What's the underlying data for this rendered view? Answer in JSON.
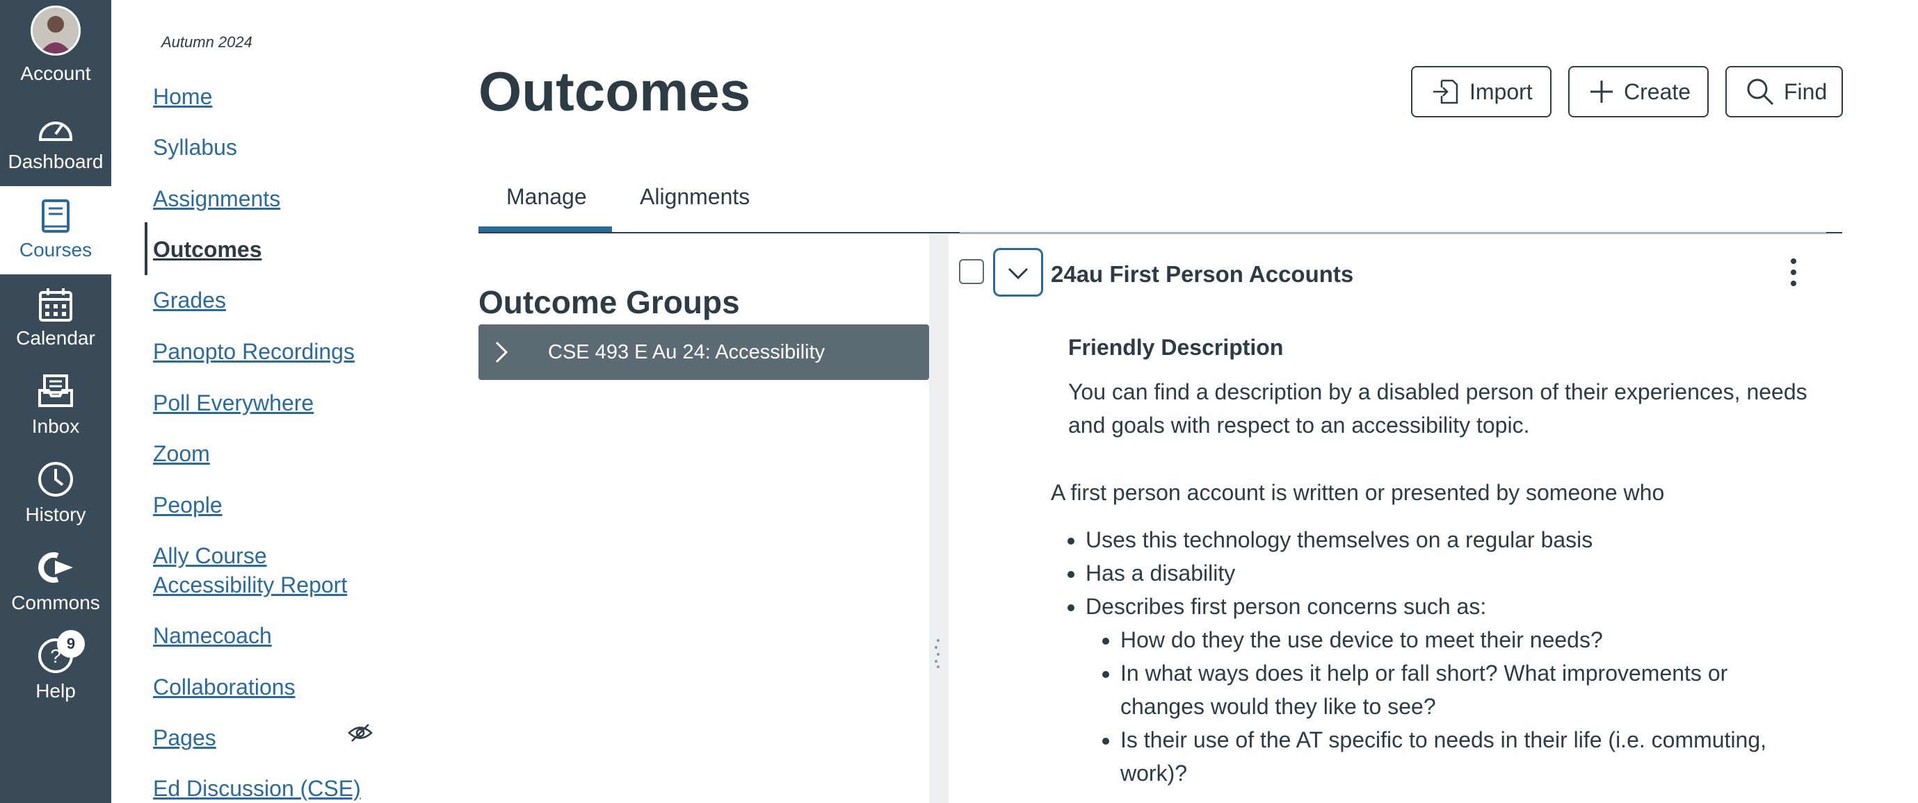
{
  "global_nav": {
    "account": "Account",
    "dashboard": "Dashboard",
    "courses": "Courses",
    "calendar": "Calendar",
    "inbox": "Inbox",
    "history": "History",
    "commons": "Commons",
    "help": "Help",
    "help_badge": "9"
  },
  "course_nav": {
    "term": "Autumn 2024",
    "items": [
      {
        "label": "Home"
      },
      {
        "label": "Syllabus"
      },
      {
        "label": "Assignments"
      },
      {
        "label": "Outcomes"
      },
      {
        "label": "Grades"
      },
      {
        "label": "Panopto Recordings"
      },
      {
        "label": "Poll Everywhere"
      },
      {
        "label": "Zoom"
      },
      {
        "label": "People"
      },
      {
        "label": "Ally Course",
        "label2": "Accessibility Report"
      },
      {
        "label": "Namecoach"
      },
      {
        "label": "Collaborations"
      },
      {
        "label": "Pages"
      },
      {
        "label": "Ed Discussion (CSE)"
      }
    ]
  },
  "header": {
    "title": "Outcomes",
    "import_label": "Import",
    "create_label": "Create",
    "find_label": "Find"
  },
  "tabs": [
    {
      "label": "Manage"
    },
    {
      "label": "Alignments"
    }
  ],
  "groups": {
    "title": "Outcome Groups",
    "items": [
      {
        "label": "CSE 493 E Au 24: Accessibility"
      }
    ]
  },
  "outcome": {
    "title": "24au First Person Accounts",
    "friendly_label": "Friendly Description",
    "friendly_text": "You can find a description by a disabled person of their experiences, needs and goals with respect to an accessibility topic.",
    "intro": "A first person account is written or presented by someone who",
    "bullets": [
      "Uses this technology themselves on a regular basis",
      "Has a disability",
      "Describes first person concerns such as:"
    ],
    "sub_bullets": [
      "How do they the use device to meet their needs?",
      "In what ways does it help or fall short? What improvements or changes would they like to see?",
      "Is their use of the AT specific to needs in their life (i.e. commuting, work)?"
    ]
  },
  "colors": {
    "nav_bg": "#394b58",
    "link": "#2b6a99",
    "text": "#2d3b45",
    "group_row": "#5c6a74"
  }
}
